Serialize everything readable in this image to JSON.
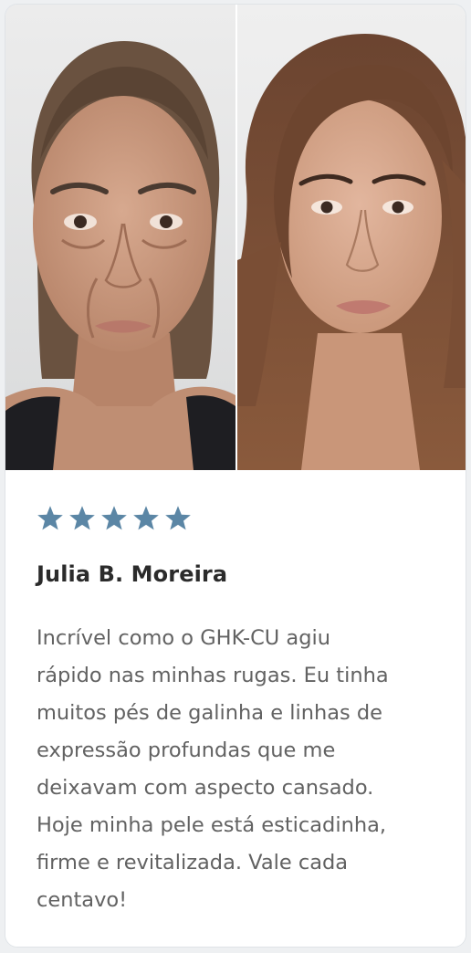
{
  "review": {
    "rating": 5,
    "rating_max": 5,
    "star_color": "#5b86a5",
    "reviewer_name": "Julia B. Moreira",
    "text": "Incrível como o GHK-CU agiu\nrápido nas minhas rugas. Eu tinha\nmuitos pés de galinha e linhas de\nexpressão profundas que me\ndeixavam com aspecto cansado.\nHoje minha pele está esticadinha,\nfirme e revitalizada. Vale cada\ncentavo!"
  },
  "photos": {
    "before_icon": "woman-portrait-before",
    "after_icon": "woman-portrait-after"
  }
}
